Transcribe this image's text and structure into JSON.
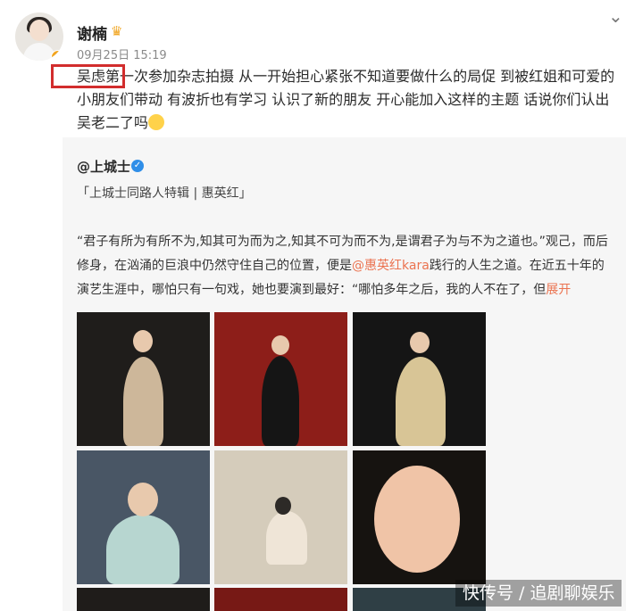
{
  "post": {
    "username": "谢楠",
    "timestamp": "09月25日 15:19",
    "text": "吴虑第一次参加杂志拍摄 从一开始担心紧张不知道要做什么的局促 到被红姐和可爱的小朋友们带动 有波折也有学习 认识了新的朋友 开心能加入这样的主题 话说你们认出吴老二了吗"
  },
  "repost": {
    "source_name": "@上城士",
    "tagline": "「上城士同路人特辑 | 惠英红」",
    "text_before": "“君子有所为有所不为,知其可为而为之,知其不可为而不为,是谓君子为与不为之道也。”观己，而后修身，在汹涌的巨浪中仍然守住自己的位置，便是",
    "mention": "@惠英红kara",
    "text_after": "践行的人生之道。在近五十年的演艺生涯中，哪怕只有一句戏，她也要演到最好：“哪怕多年之后，我的人不在了，但",
    "expand": "展开"
  },
  "watermark": "快传号 / 追剧聊娱乐",
  "icons": {
    "avatar": "avatar-icon",
    "crown": "crown-icon",
    "verify": "verified-icon",
    "menu": "chevron-down-icon"
  },
  "colors": {
    "highlight": "#d22d2d",
    "mention": "#eb7350",
    "verify": "#2f8ee8"
  }
}
